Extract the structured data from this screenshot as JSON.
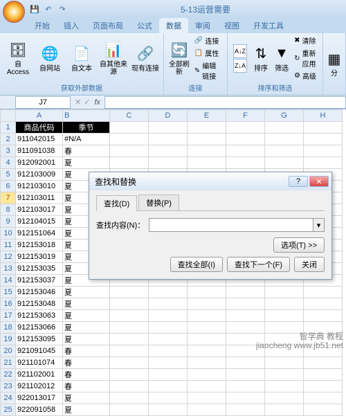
{
  "title": "5-13运营需要",
  "qat_icons": [
    "save-icon",
    "undo-icon",
    "redo-icon"
  ],
  "tabs": [
    "开始",
    "插入",
    "页面布局",
    "公式",
    "数据",
    "审阅",
    "视图",
    "开发工具"
  ],
  "active_tab": 4,
  "ribbon": {
    "ext": {
      "access": "自 Access",
      "web": "自网站",
      "text": "自文本",
      "other": "自其他来源",
      "existing": "现有连接",
      "label": "获取外部数据"
    },
    "conn": {
      "refresh": "全部刷新",
      "conn": "连接",
      "prop": "属性",
      "edit": "编辑链接",
      "label": "连接"
    },
    "sort": {
      "az": "A↓Z",
      "za": "Z↓A",
      "sort": "排序",
      "filter": "筛选",
      "clear": "清除",
      "reapply": "重新应用",
      "adv": "高级",
      "label": "排序和筛选"
    },
    "split": "分"
  },
  "namebox": "J7",
  "columns": [
    "A",
    "B",
    "C",
    "D",
    "E",
    "F",
    "G",
    "H"
  ],
  "selected_row": 7,
  "header_row": {
    "A": "商品代码",
    "B": "季节"
  },
  "rows": [
    {
      "n": 2,
      "A": "911042015",
      "B": "#N/A"
    },
    {
      "n": 3,
      "A": "911091038",
      "B": "春"
    },
    {
      "n": 4,
      "A": "912092001",
      "B": "夏"
    },
    {
      "n": 5,
      "A": "912103009",
      "B": "夏"
    },
    {
      "n": 6,
      "A": "912103010",
      "B": "夏"
    },
    {
      "n": 7,
      "A": "912103011",
      "B": "夏"
    },
    {
      "n": 8,
      "A": "912103017",
      "B": "夏"
    },
    {
      "n": 9,
      "A": "912104015",
      "B": "夏"
    },
    {
      "n": 10,
      "A": "912151064",
      "B": "夏"
    },
    {
      "n": 11,
      "A": "912153018",
      "B": "夏"
    },
    {
      "n": 12,
      "A": "912153019",
      "B": "夏"
    },
    {
      "n": 13,
      "A": "912153035",
      "B": "夏"
    },
    {
      "n": 14,
      "A": "912153037",
      "B": "夏"
    },
    {
      "n": 15,
      "A": "912153046",
      "B": "夏"
    },
    {
      "n": 16,
      "A": "912153048",
      "B": "夏"
    },
    {
      "n": 17,
      "A": "912153063",
      "B": "夏"
    },
    {
      "n": 18,
      "A": "912153066",
      "B": "夏"
    },
    {
      "n": 19,
      "A": "912153095",
      "B": "夏"
    },
    {
      "n": 20,
      "A": "921091045",
      "B": "春"
    },
    {
      "n": 21,
      "A": "921101074",
      "B": "春"
    },
    {
      "n": 22,
      "A": "921102001",
      "B": "春"
    },
    {
      "n": 23,
      "A": "921102012",
      "B": "春"
    },
    {
      "n": 24,
      "A": "922013017",
      "B": "夏"
    },
    {
      "n": 25,
      "A": "922091058",
      "B": "夏"
    }
  ],
  "dialog": {
    "title": "查找和替换",
    "tab_find": "查找(D)",
    "tab_replace": "替换(P)",
    "find_label": "查找内容(N)：",
    "find_value": "",
    "options": "选项(T) >>",
    "find_all": "查找全部(I)",
    "find_next": "查找下一个(F)",
    "close": "关闭"
  },
  "watermark": {
    "l1": "智学典 教程",
    "l2": "jiaocheng   www.jb51.net"
  }
}
